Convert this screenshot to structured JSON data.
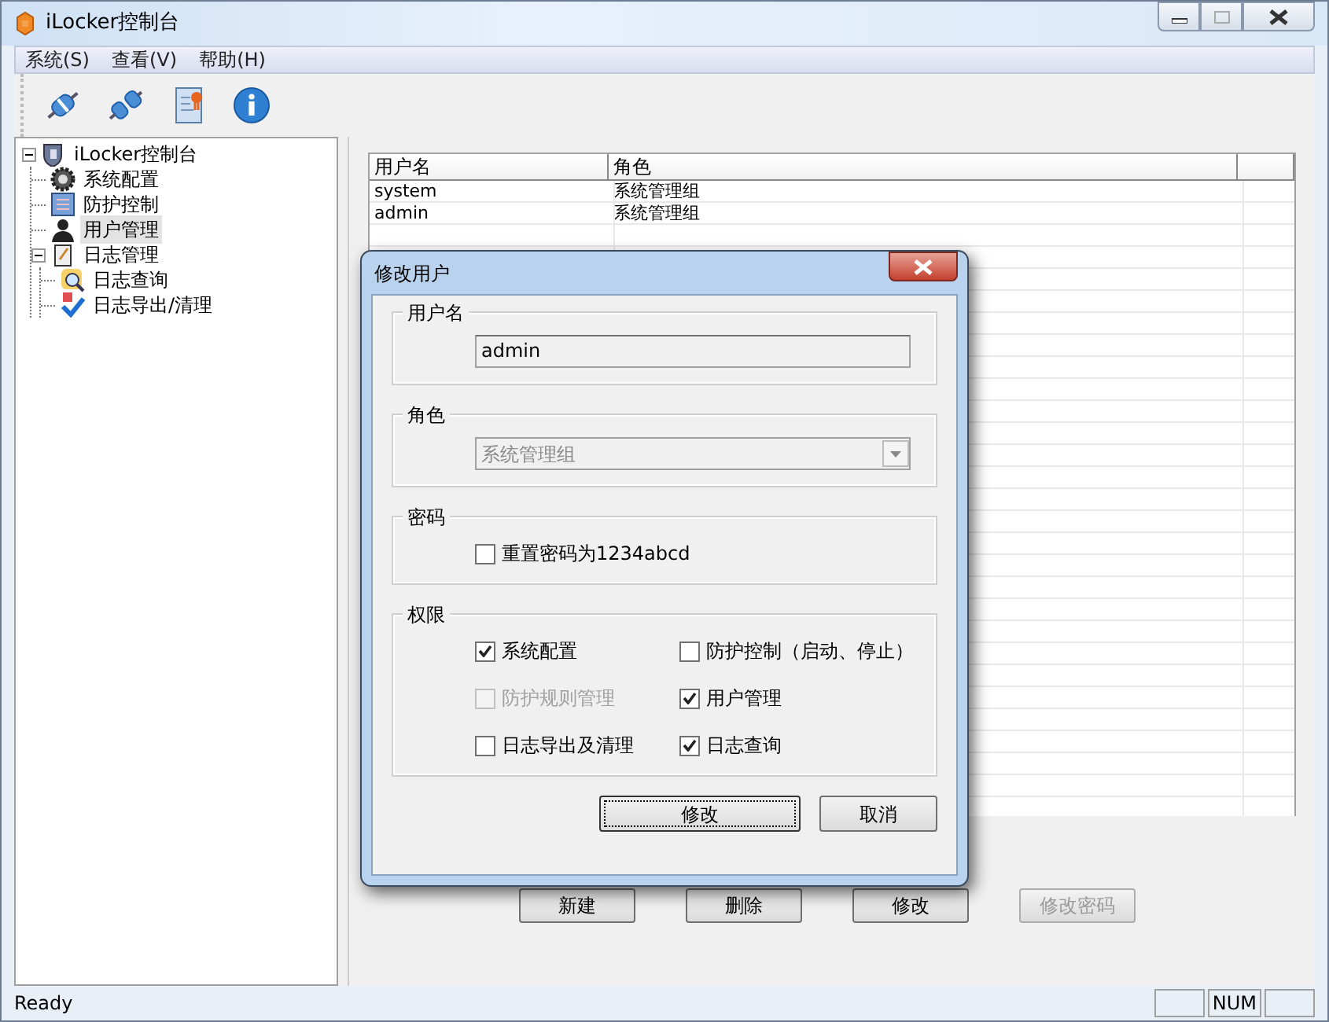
{
  "window": {
    "title": "iLocker控制台"
  },
  "menu": [
    {
      "label": "系统(S)"
    },
    {
      "label": "查看(V)"
    },
    {
      "label": "帮助(H)"
    }
  ],
  "toolbar": [
    {
      "kind": "connect"
    },
    {
      "kind": "disconnect"
    },
    {
      "kind": "certificate"
    },
    {
      "kind": "info"
    }
  ],
  "tree": [
    {
      "label": "iLocker控制台",
      "kind": "shield",
      "expanded": true,
      "selected": false,
      "children": [
        {
          "label": "系统配置",
          "kind": "gear",
          "selected": false
        },
        {
          "label": "防护控制",
          "kind": "panel",
          "selected": false
        },
        {
          "label": "用户管理",
          "kind": "user",
          "selected": true
        },
        {
          "label": "日志管理",
          "kind": "log",
          "expanded": true,
          "selected": false,
          "children": [
            {
              "label": "日志查询",
              "kind": "search",
              "selected": false
            },
            {
              "label": "日志导出/清理",
              "kind": "export",
              "selected": false
            }
          ]
        }
      ]
    }
  ],
  "table": {
    "columns": [
      "用户名",
      "角色"
    ],
    "rows": [
      [
        "system",
        "系统管理组"
      ],
      [
        "admin",
        "系统管理组"
      ]
    ]
  },
  "buttons": [
    {
      "label": "新建",
      "disabled": false
    },
    {
      "label": "删除",
      "disabled": false
    },
    {
      "label": "修改",
      "disabled": false
    },
    {
      "label": "修改密码",
      "disabled": true
    }
  ],
  "dialog": {
    "title": "修改用户",
    "groups": [
      {
        "legend": "用户名",
        "kind": "text",
        "value": "admin"
      },
      {
        "legend": "角色",
        "kind": "select",
        "value": "系统管理组"
      },
      {
        "legend": "密码",
        "kind": "checks",
        "items": [
          {
            "label": "重置密码为1234abcd",
            "checked": false,
            "disabled": false
          }
        ]
      },
      {
        "legend": "权限",
        "kind": "checks",
        "items": [
          {
            "label": "系统配置",
            "checked": true,
            "disabled": false
          },
          {
            "label": "防护控制（启动、停止）",
            "checked": false,
            "disabled": false
          },
          {
            "label": "防护规则管理",
            "checked": false,
            "disabled": true
          },
          {
            "label": "用户管理",
            "checked": true,
            "disabled": false
          },
          {
            "label": "日志导出及清理",
            "checked": false,
            "disabled": false
          },
          {
            "label": "日志查询",
            "checked": true,
            "disabled": false
          }
        ]
      }
    ],
    "buttons": [
      {
        "label": "修改",
        "focused": true
      },
      {
        "label": "取消",
        "focused": false
      }
    ]
  },
  "status_bar": {
    "text": "Ready",
    "indicators": [
      "NUM"
    ]
  }
}
